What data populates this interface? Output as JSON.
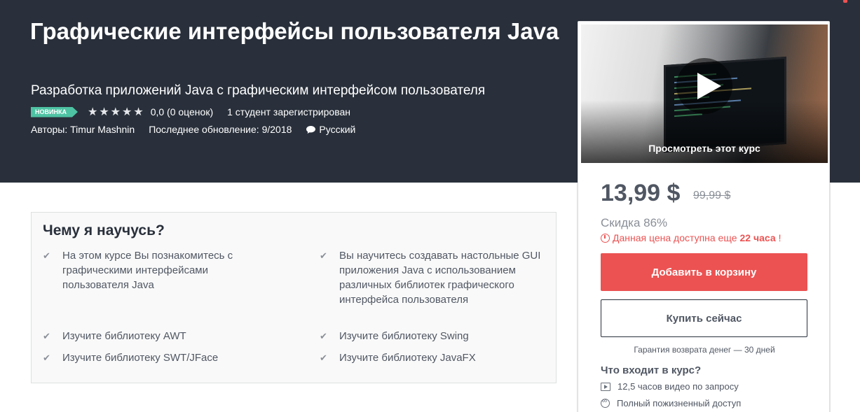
{
  "course": {
    "title": "Графические интерфейсы пользователя Java",
    "subtitle": "Разработка приложений Java с графическим интерфейсом пользователя",
    "badge": "НОВИНКА",
    "rating": "0,0 (0 оценок)",
    "rating_value": 0,
    "students": "1 студент зарегистрирован",
    "authors": "Авторы: Timur Mashnin",
    "updated": "Последнее обновление: 9/2018",
    "language": "Русский"
  },
  "sidebar": {
    "preview_label": "Просмотреть этот курс",
    "price": "13,99 $",
    "old_price": "99,99 $",
    "discount": "Скидка 86%",
    "timer_prefix": "Данная цена доступна еще ",
    "timer_value": "22 часа",
    "timer_suffix": "!",
    "add_to_cart": "Добавить в корзину",
    "buy_now": "Купить сейчас",
    "guarantee": "Гарантия возврата денег — 30 дней",
    "includes_title": "Что входит в курс?",
    "includes": [
      {
        "icon": "video-icon",
        "text": "12,5 часов видео по запросу"
      },
      {
        "icon": "infinity-icon",
        "text": "Полный пожизненный доступ"
      }
    ]
  },
  "learn": {
    "title": "Чему я научусь?",
    "items": [
      "На этом курсе Вы познакомитесь с графическими интерфейсами пользователя Java",
      "Вы научитесь создавать настольные GUI приложения Java с использованием различных библиотек графического интерфейса пользователя",
      "Изучите библиотеку AWT",
      "Изучите библиотеку Swing",
      "Изучите библиотеку SWT/JFace",
      "Изучите библиотеку JavaFX"
    ]
  },
  "colors": {
    "hero_bg": "#29303b",
    "accent": "#ec5252",
    "badge": "#4ec3a3"
  }
}
